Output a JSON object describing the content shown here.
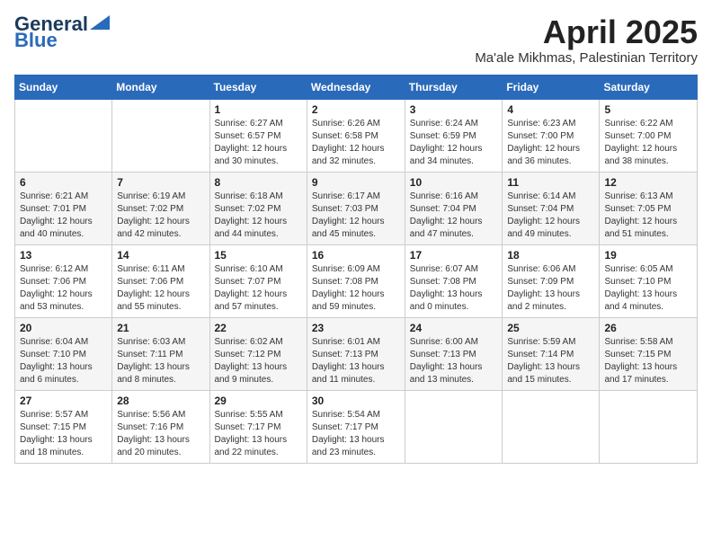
{
  "logo": {
    "line1": "General",
    "line2": "Blue"
  },
  "title": "April 2025",
  "location": "Ma'ale Mikhmas, Palestinian Territory",
  "weekdays": [
    "Sunday",
    "Monday",
    "Tuesday",
    "Wednesday",
    "Thursday",
    "Friday",
    "Saturday"
  ],
  "weeks": [
    [
      {
        "day": "",
        "content": ""
      },
      {
        "day": "",
        "content": ""
      },
      {
        "day": "1",
        "content": "Sunrise: 6:27 AM\nSunset: 6:57 PM\nDaylight: 12 hours\nand 30 minutes."
      },
      {
        "day": "2",
        "content": "Sunrise: 6:26 AM\nSunset: 6:58 PM\nDaylight: 12 hours\nand 32 minutes."
      },
      {
        "day": "3",
        "content": "Sunrise: 6:24 AM\nSunset: 6:59 PM\nDaylight: 12 hours\nand 34 minutes."
      },
      {
        "day": "4",
        "content": "Sunrise: 6:23 AM\nSunset: 7:00 PM\nDaylight: 12 hours\nand 36 minutes."
      },
      {
        "day": "5",
        "content": "Sunrise: 6:22 AM\nSunset: 7:00 PM\nDaylight: 12 hours\nand 38 minutes."
      }
    ],
    [
      {
        "day": "6",
        "content": "Sunrise: 6:21 AM\nSunset: 7:01 PM\nDaylight: 12 hours\nand 40 minutes."
      },
      {
        "day": "7",
        "content": "Sunrise: 6:19 AM\nSunset: 7:02 PM\nDaylight: 12 hours\nand 42 minutes."
      },
      {
        "day": "8",
        "content": "Sunrise: 6:18 AM\nSunset: 7:02 PM\nDaylight: 12 hours\nand 44 minutes."
      },
      {
        "day": "9",
        "content": "Sunrise: 6:17 AM\nSunset: 7:03 PM\nDaylight: 12 hours\nand 45 minutes."
      },
      {
        "day": "10",
        "content": "Sunrise: 6:16 AM\nSunset: 7:04 PM\nDaylight: 12 hours\nand 47 minutes."
      },
      {
        "day": "11",
        "content": "Sunrise: 6:14 AM\nSunset: 7:04 PM\nDaylight: 12 hours\nand 49 minutes."
      },
      {
        "day": "12",
        "content": "Sunrise: 6:13 AM\nSunset: 7:05 PM\nDaylight: 12 hours\nand 51 minutes."
      }
    ],
    [
      {
        "day": "13",
        "content": "Sunrise: 6:12 AM\nSunset: 7:06 PM\nDaylight: 12 hours\nand 53 minutes."
      },
      {
        "day": "14",
        "content": "Sunrise: 6:11 AM\nSunset: 7:06 PM\nDaylight: 12 hours\nand 55 minutes."
      },
      {
        "day": "15",
        "content": "Sunrise: 6:10 AM\nSunset: 7:07 PM\nDaylight: 12 hours\nand 57 minutes."
      },
      {
        "day": "16",
        "content": "Sunrise: 6:09 AM\nSunset: 7:08 PM\nDaylight: 12 hours\nand 59 minutes."
      },
      {
        "day": "17",
        "content": "Sunrise: 6:07 AM\nSunset: 7:08 PM\nDaylight: 13 hours\nand 0 minutes."
      },
      {
        "day": "18",
        "content": "Sunrise: 6:06 AM\nSunset: 7:09 PM\nDaylight: 13 hours\nand 2 minutes."
      },
      {
        "day": "19",
        "content": "Sunrise: 6:05 AM\nSunset: 7:10 PM\nDaylight: 13 hours\nand 4 minutes."
      }
    ],
    [
      {
        "day": "20",
        "content": "Sunrise: 6:04 AM\nSunset: 7:10 PM\nDaylight: 13 hours\nand 6 minutes."
      },
      {
        "day": "21",
        "content": "Sunrise: 6:03 AM\nSunset: 7:11 PM\nDaylight: 13 hours\nand 8 minutes."
      },
      {
        "day": "22",
        "content": "Sunrise: 6:02 AM\nSunset: 7:12 PM\nDaylight: 13 hours\nand 9 minutes."
      },
      {
        "day": "23",
        "content": "Sunrise: 6:01 AM\nSunset: 7:13 PM\nDaylight: 13 hours\nand 11 minutes."
      },
      {
        "day": "24",
        "content": "Sunrise: 6:00 AM\nSunset: 7:13 PM\nDaylight: 13 hours\nand 13 minutes."
      },
      {
        "day": "25",
        "content": "Sunrise: 5:59 AM\nSunset: 7:14 PM\nDaylight: 13 hours\nand 15 minutes."
      },
      {
        "day": "26",
        "content": "Sunrise: 5:58 AM\nSunset: 7:15 PM\nDaylight: 13 hours\nand 17 minutes."
      }
    ],
    [
      {
        "day": "27",
        "content": "Sunrise: 5:57 AM\nSunset: 7:15 PM\nDaylight: 13 hours\nand 18 minutes."
      },
      {
        "day": "28",
        "content": "Sunrise: 5:56 AM\nSunset: 7:16 PM\nDaylight: 13 hours\nand 20 minutes."
      },
      {
        "day": "29",
        "content": "Sunrise: 5:55 AM\nSunset: 7:17 PM\nDaylight: 13 hours\nand 22 minutes."
      },
      {
        "day": "30",
        "content": "Sunrise: 5:54 AM\nSunset: 7:17 PM\nDaylight: 13 hours\nand 23 minutes."
      },
      {
        "day": "",
        "content": ""
      },
      {
        "day": "",
        "content": ""
      },
      {
        "day": "",
        "content": ""
      }
    ]
  ]
}
